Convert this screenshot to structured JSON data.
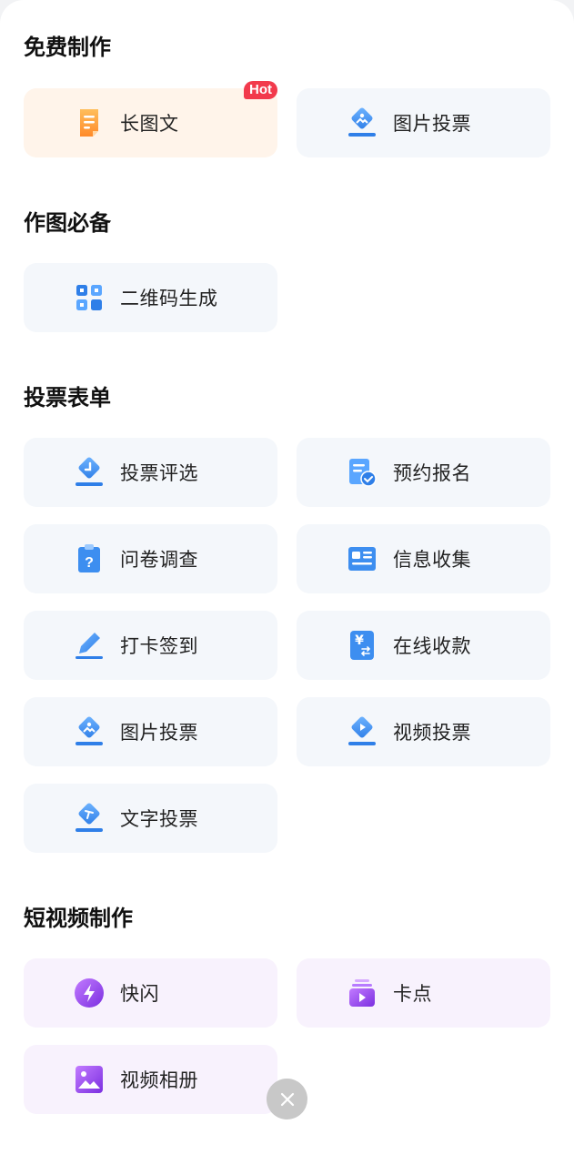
{
  "sections": [
    {
      "title": "免费制作",
      "items": [
        {
          "label": "长图文",
          "icon": "long-article-icon",
          "badge": "Hot"
        },
        {
          "label": "图片投票",
          "icon": "image-vote-icon"
        }
      ]
    },
    {
      "title": "作图必备",
      "items": [
        {
          "label": "二维码生成",
          "icon": "qr-code-icon"
        }
      ]
    },
    {
      "title": "投票表单",
      "items": [
        {
          "label": "投票评选",
          "icon": "vote-select-icon"
        },
        {
          "label": "预约报名",
          "icon": "appointment-icon"
        },
        {
          "label": "问卷调查",
          "icon": "questionnaire-icon"
        },
        {
          "label": "信息收集",
          "icon": "info-collect-icon"
        },
        {
          "label": "打卡签到",
          "icon": "check-in-icon"
        },
        {
          "label": "在线收款",
          "icon": "online-payment-icon"
        },
        {
          "label": "图片投票",
          "icon": "image-vote-icon"
        },
        {
          "label": "视频投票",
          "icon": "video-vote-icon"
        },
        {
          "label": "文字投票",
          "icon": "text-vote-icon"
        }
      ]
    },
    {
      "title": "短视频制作",
      "items": [
        {
          "label": "快闪",
          "icon": "flash-icon"
        },
        {
          "label": "卡点",
          "icon": "beat-sync-icon"
        },
        {
          "label": "视频相册",
          "icon": "video-album-icon"
        }
      ]
    }
  ],
  "colors": {
    "blue": "#3d8ef0",
    "orange": "#ff9a3c",
    "purple": "#9b4ae8",
    "hot_badge": "#f23a4c"
  },
  "close_icon": "close-icon"
}
